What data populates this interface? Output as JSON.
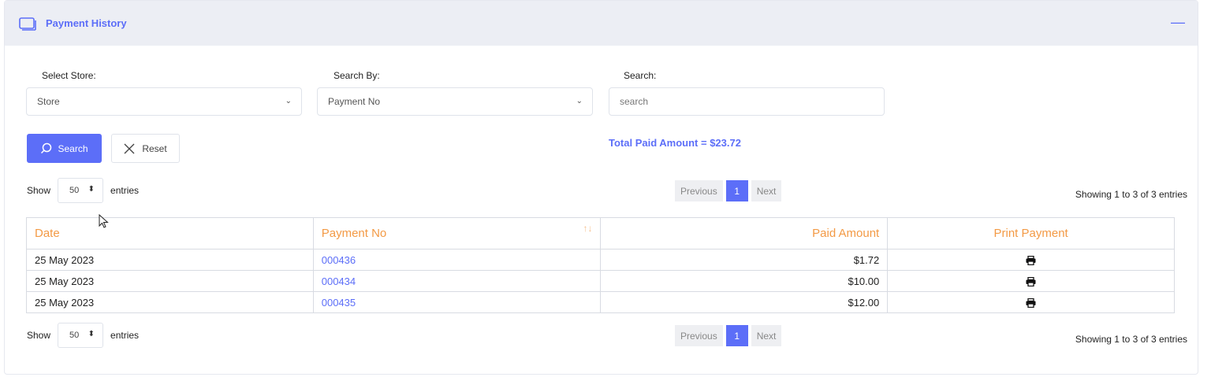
{
  "header": {
    "title": "Payment History",
    "collapse_symbol": "—"
  },
  "filters": {
    "store_label": "Select Store:",
    "store_value": "Store",
    "search_by_label": "Search By:",
    "search_by_value": "Payment No",
    "search_label": "Search:",
    "search_placeholder": "search"
  },
  "buttons": {
    "search": "Search",
    "reset": "Reset"
  },
  "total": "Total Paid Amount = $23.72",
  "length": {
    "show": "Show",
    "value": "50",
    "entries": "entries"
  },
  "pager": {
    "previous": "Previous",
    "current": "1",
    "next": "Next"
  },
  "info": "Showing 1 to 3 of 3 entries",
  "table": {
    "headers": [
      "Date",
      "Payment No",
      "Paid Amount",
      "Print Payment"
    ],
    "sort_indicator": "↑↓",
    "rows": [
      {
        "date": "25 May 2023",
        "payment_no": "000436",
        "amount": "$1.72"
      },
      {
        "date": "25 May 2023",
        "payment_no": "000434",
        "amount": "$10.00"
      },
      {
        "date": "25 May 2023",
        "payment_no": "000435",
        "amount": "$12.00"
      }
    ]
  },
  "colors": {
    "accent": "#5c6ef8",
    "header_text": "#f39a45",
    "header_bg": "#eceef4"
  },
  "icons": {
    "header": "window-icon",
    "search": "search-icon",
    "reset": "close-icon",
    "print": "printer-icon",
    "collapse": "minus-icon"
  }
}
